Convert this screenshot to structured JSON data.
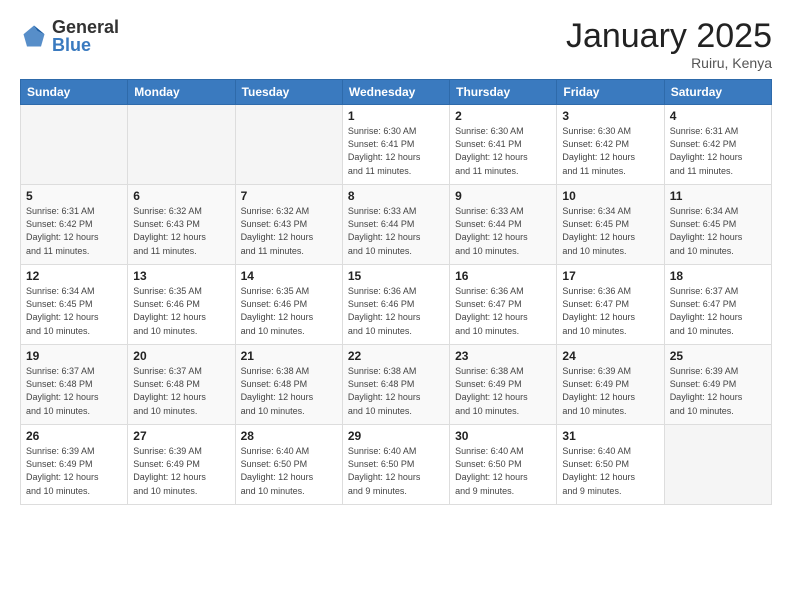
{
  "header": {
    "logo_general": "General",
    "logo_blue": "Blue",
    "title": "January 2025",
    "subtitle": "Ruiru, Kenya"
  },
  "days_of_week": [
    "Sunday",
    "Monday",
    "Tuesday",
    "Wednesday",
    "Thursday",
    "Friday",
    "Saturday"
  ],
  "weeks": [
    [
      {
        "num": "",
        "info": ""
      },
      {
        "num": "",
        "info": ""
      },
      {
        "num": "",
        "info": ""
      },
      {
        "num": "1",
        "info": "Sunrise: 6:30 AM\nSunset: 6:41 PM\nDaylight: 12 hours\nand 11 minutes."
      },
      {
        "num": "2",
        "info": "Sunrise: 6:30 AM\nSunset: 6:41 PM\nDaylight: 12 hours\nand 11 minutes."
      },
      {
        "num": "3",
        "info": "Sunrise: 6:30 AM\nSunset: 6:42 PM\nDaylight: 12 hours\nand 11 minutes."
      },
      {
        "num": "4",
        "info": "Sunrise: 6:31 AM\nSunset: 6:42 PM\nDaylight: 12 hours\nand 11 minutes."
      }
    ],
    [
      {
        "num": "5",
        "info": "Sunrise: 6:31 AM\nSunset: 6:42 PM\nDaylight: 12 hours\nand 11 minutes."
      },
      {
        "num": "6",
        "info": "Sunrise: 6:32 AM\nSunset: 6:43 PM\nDaylight: 12 hours\nand 11 minutes."
      },
      {
        "num": "7",
        "info": "Sunrise: 6:32 AM\nSunset: 6:43 PM\nDaylight: 12 hours\nand 11 minutes."
      },
      {
        "num": "8",
        "info": "Sunrise: 6:33 AM\nSunset: 6:44 PM\nDaylight: 12 hours\nand 10 minutes."
      },
      {
        "num": "9",
        "info": "Sunrise: 6:33 AM\nSunset: 6:44 PM\nDaylight: 12 hours\nand 10 minutes."
      },
      {
        "num": "10",
        "info": "Sunrise: 6:34 AM\nSunset: 6:45 PM\nDaylight: 12 hours\nand 10 minutes."
      },
      {
        "num": "11",
        "info": "Sunrise: 6:34 AM\nSunset: 6:45 PM\nDaylight: 12 hours\nand 10 minutes."
      }
    ],
    [
      {
        "num": "12",
        "info": "Sunrise: 6:34 AM\nSunset: 6:45 PM\nDaylight: 12 hours\nand 10 minutes."
      },
      {
        "num": "13",
        "info": "Sunrise: 6:35 AM\nSunset: 6:46 PM\nDaylight: 12 hours\nand 10 minutes."
      },
      {
        "num": "14",
        "info": "Sunrise: 6:35 AM\nSunset: 6:46 PM\nDaylight: 12 hours\nand 10 minutes."
      },
      {
        "num": "15",
        "info": "Sunrise: 6:36 AM\nSunset: 6:46 PM\nDaylight: 12 hours\nand 10 minutes."
      },
      {
        "num": "16",
        "info": "Sunrise: 6:36 AM\nSunset: 6:47 PM\nDaylight: 12 hours\nand 10 minutes."
      },
      {
        "num": "17",
        "info": "Sunrise: 6:36 AM\nSunset: 6:47 PM\nDaylight: 12 hours\nand 10 minutes."
      },
      {
        "num": "18",
        "info": "Sunrise: 6:37 AM\nSunset: 6:47 PM\nDaylight: 12 hours\nand 10 minutes."
      }
    ],
    [
      {
        "num": "19",
        "info": "Sunrise: 6:37 AM\nSunset: 6:48 PM\nDaylight: 12 hours\nand 10 minutes."
      },
      {
        "num": "20",
        "info": "Sunrise: 6:37 AM\nSunset: 6:48 PM\nDaylight: 12 hours\nand 10 minutes."
      },
      {
        "num": "21",
        "info": "Sunrise: 6:38 AM\nSunset: 6:48 PM\nDaylight: 12 hours\nand 10 minutes."
      },
      {
        "num": "22",
        "info": "Sunrise: 6:38 AM\nSunset: 6:48 PM\nDaylight: 12 hours\nand 10 minutes."
      },
      {
        "num": "23",
        "info": "Sunrise: 6:38 AM\nSunset: 6:49 PM\nDaylight: 12 hours\nand 10 minutes."
      },
      {
        "num": "24",
        "info": "Sunrise: 6:39 AM\nSunset: 6:49 PM\nDaylight: 12 hours\nand 10 minutes."
      },
      {
        "num": "25",
        "info": "Sunrise: 6:39 AM\nSunset: 6:49 PM\nDaylight: 12 hours\nand 10 minutes."
      }
    ],
    [
      {
        "num": "26",
        "info": "Sunrise: 6:39 AM\nSunset: 6:49 PM\nDaylight: 12 hours\nand 10 minutes."
      },
      {
        "num": "27",
        "info": "Sunrise: 6:39 AM\nSunset: 6:49 PM\nDaylight: 12 hours\nand 10 minutes."
      },
      {
        "num": "28",
        "info": "Sunrise: 6:40 AM\nSunset: 6:50 PM\nDaylight: 12 hours\nand 10 minutes."
      },
      {
        "num": "29",
        "info": "Sunrise: 6:40 AM\nSunset: 6:50 PM\nDaylight: 12 hours\nand 9 minutes."
      },
      {
        "num": "30",
        "info": "Sunrise: 6:40 AM\nSunset: 6:50 PM\nDaylight: 12 hours\nand 9 minutes."
      },
      {
        "num": "31",
        "info": "Sunrise: 6:40 AM\nSunset: 6:50 PM\nDaylight: 12 hours\nand 9 minutes."
      },
      {
        "num": "",
        "info": ""
      }
    ]
  ]
}
